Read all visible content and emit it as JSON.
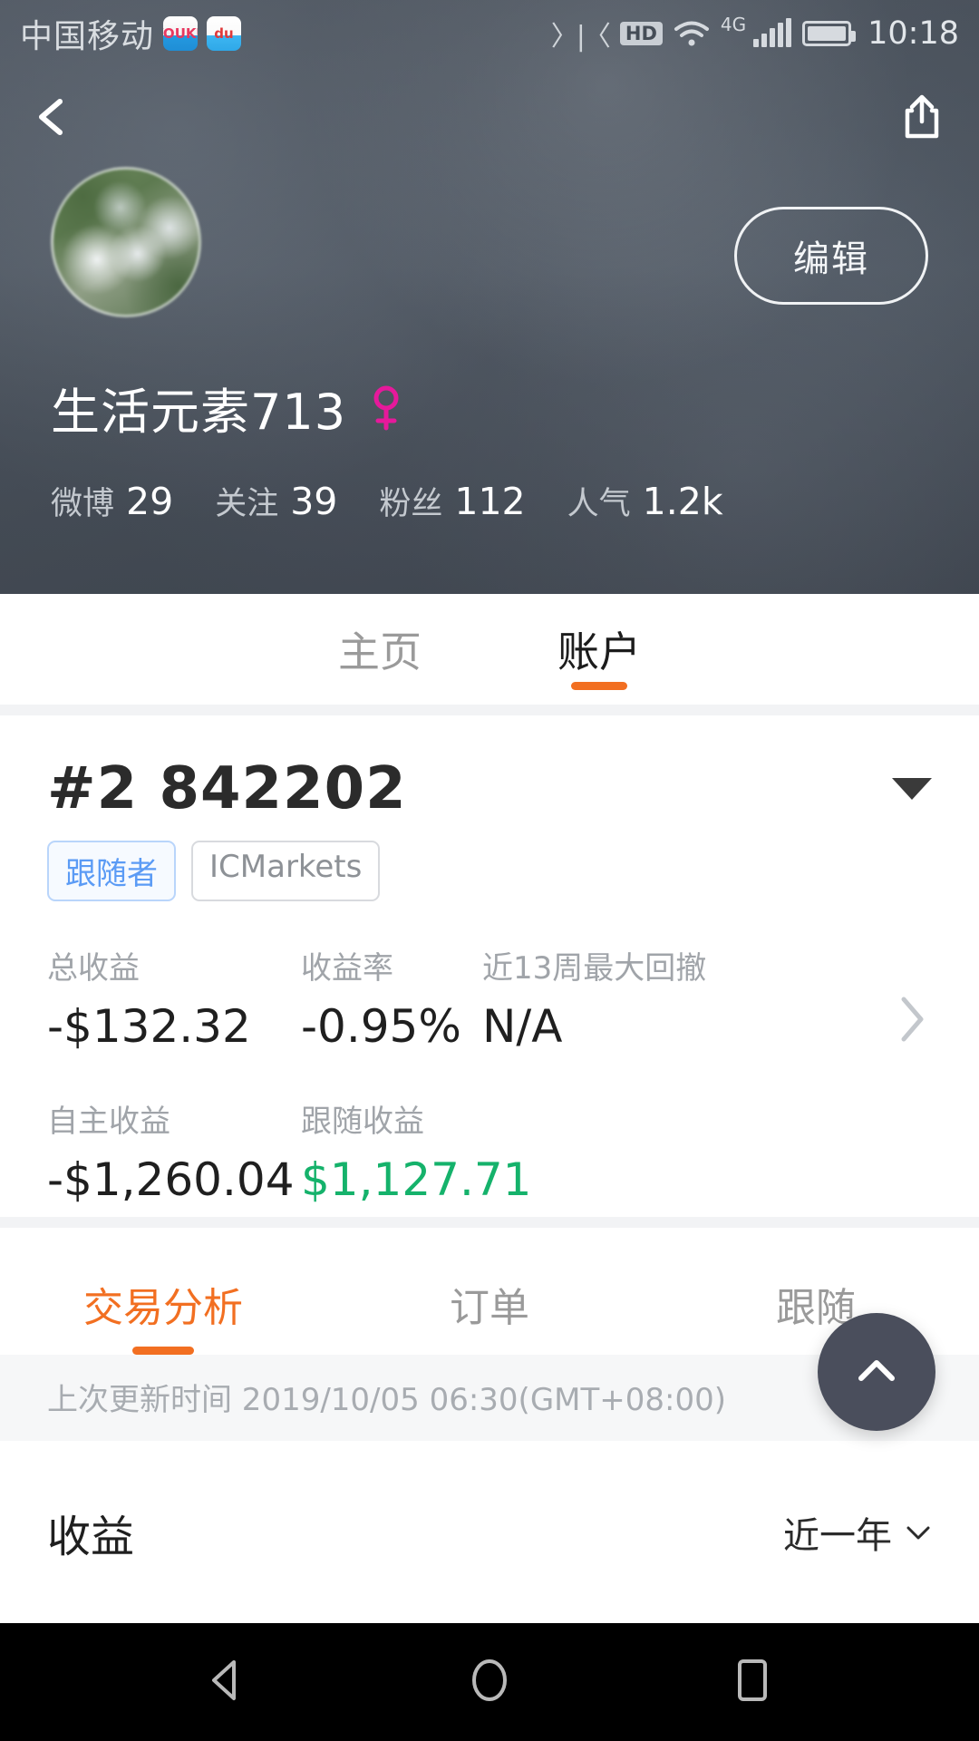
{
  "status_bar": {
    "carrier": "中国移动",
    "app_icons": [
      {
        "name": "youku-icon",
        "label": "YOUKU"
      },
      {
        "name": "baidu-icon",
        "label": "du"
      }
    ],
    "vibrate_icon": "vibrate-icon",
    "hd_label": "HD",
    "wifi_icon": "wifi-icon",
    "network_label": "4G",
    "signal_icon": "signal-bars-icon",
    "battery_icon": "battery-icon",
    "time": "10:18"
  },
  "top_nav": {
    "back_icon": "back-chevron-icon",
    "share_icon": "share-icon"
  },
  "profile": {
    "avatar": "user-avatar",
    "edit_label": "编辑",
    "username": "生活元素713",
    "gender_icon": "female-gender-icon",
    "stats": [
      {
        "label": "微博",
        "value": "29"
      },
      {
        "label": "关注",
        "value": "39"
      },
      {
        "label": "粉丝",
        "value": "112"
      },
      {
        "label": "人气",
        "value": "1.2k"
      }
    ]
  },
  "main_tabs": [
    {
      "label": "主页",
      "active": false
    },
    {
      "label": "账户",
      "active": true
    }
  ],
  "account": {
    "number": "#2 842202",
    "dropdown_icon": "chevron-down-icon",
    "badges": [
      {
        "label": "跟随者",
        "type": "follower"
      },
      {
        "label": "ICMarkets",
        "type": "broker"
      }
    ],
    "metrics_row1": [
      {
        "label": "总收益",
        "value": "-$132.32",
        "color": "dark"
      },
      {
        "label": "收益率",
        "value": "-0.95%",
        "color": "dark"
      },
      {
        "label": "近13周最大回撤",
        "value": "N/A",
        "color": "dark"
      }
    ],
    "metrics_row2": [
      {
        "label": "自主收益",
        "value": "-$1,260.04",
        "color": "dark"
      },
      {
        "label": "跟随收益",
        "value": "$1,127.71",
        "color": "green"
      }
    ],
    "detail_chevron_icon": "chevron-right-icon"
  },
  "sub_tabs": [
    {
      "label": "交易分析",
      "active": true
    },
    {
      "label": "订单",
      "active": false
    },
    {
      "label": "跟随",
      "active": false
    }
  ],
  "updated": {
    "text": "上次更新时间 2019/10/05 06:30(GMT+08:00)"
  },
  "fab": {
    "icon": "scroll-to-top-icon"
  },
  "earnings": {
    "title": "收益",
    "range_label": "近一年",
    "range_icon": "chevron-down-icon"
  },
  "android_nav": {
    "back_icon": "android-back-icon",
    "home_icon": "android-home-icon",
    "recents_icon": "android-recents-icon"
  },
  "colors": {
    "accent_orange": "#f26f21",
    "positive_green": "#15b26b",
    "badge_blue": "#5b9bf5",
    "gender_pink": "#e6199b"
  }
}
